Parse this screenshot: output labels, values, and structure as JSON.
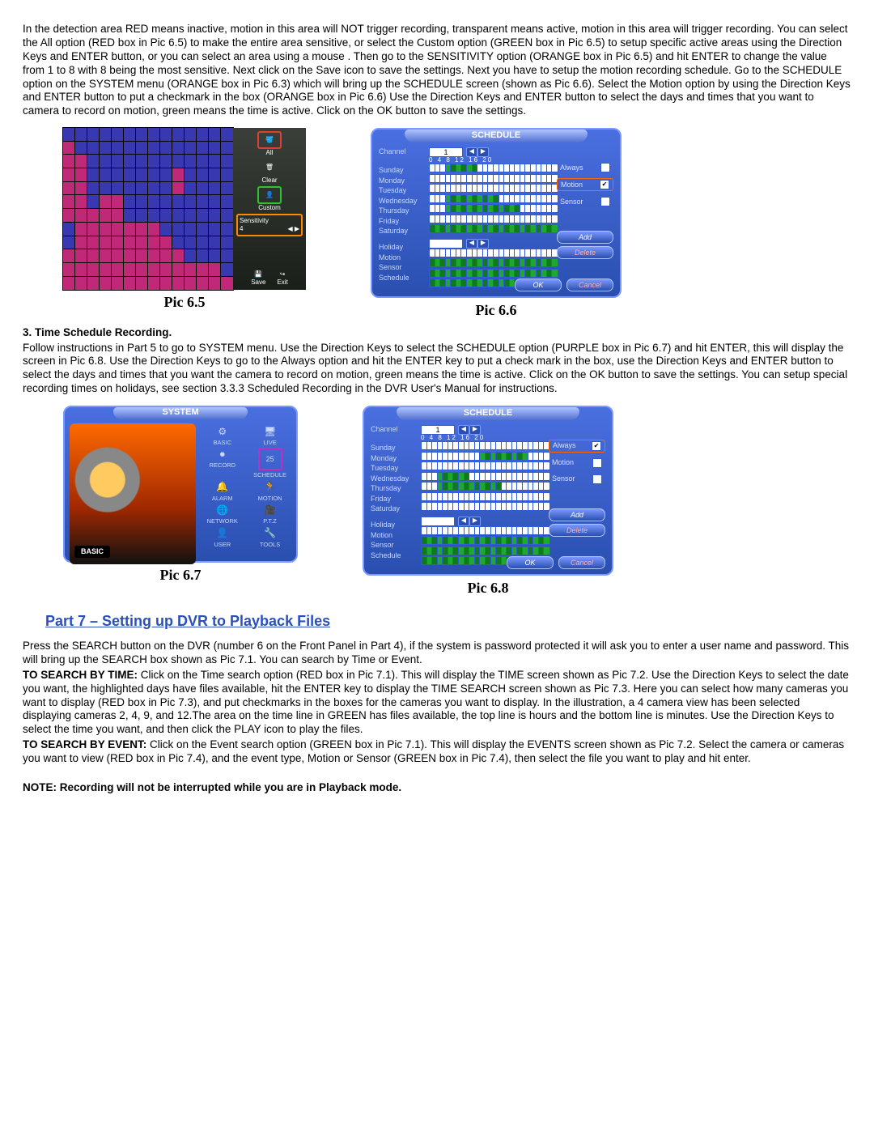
{
  "para1": "In the detection area RED means inactive, motion in this area will NOT trigger recording, transparent means active, motion in this area will trigger recording. You can select the All option (RED box in Pic 6.5) to make the entire area sensitive, or select the Custom option (GREEN box in Pic 6.5) to setup specific active areas using the Direction Keys and ENTER button, or you can select an area using a mouse . Then go to the SENSITIVITY option (ORANGE box in Pic 6.5) and hit ENTER to change the value from 1 to 8 with 8 being the most sensitive. Next click on the Save icon to save the settings. Next you have to setup the motion recording schedule. Go to the SCHEDULE option on the SYSTEM menu (ORANGE box in Pic 6.3) which will bring up the SCHEDULE screen (shown as Pic 6.6).  Select the Motion option by using the Direction Keys and ENTER button to put a checkmark in the box (ORANGE box in Pic 6.6) Use the Direction Keys and ENTER button to select the days and times that you want to camera to record on motion, green means the time is active. Click on the OK button to save the settings.",
  "pic65": {
    "caption": "Pic 6.5",
    "side": {
      "all": "All",
      "clear": "Clear",
      "custom": "Custom",
      "sens_label": "Sensitivity",
      "sens_val": "4",
      "save": "Save",
      "exit": "Exit"
    }
  },
  "pic66": {
    "caption": "Pic 6.6",
    "title": "SCHEDULE",
    "labels": {
      "channel": "Channel",
      "sunday": "Sunday",
      "monday": "Monday",
      "tuesday": "Tuesday",
      "wednesday": "Wednesday",
      "thursday": "Thursday",
      "friday": "Friday",
      "saturday": "Saturday",
      "holiday": "Holiday",
      "motion": "Motion",
      "sensor": "Sensor",
      "schedule": "Schedule"
    },
    "channel_val": "1",
    "ticks": "0    4    8    12   16   20",
    "opts": {
      "always": "Always",
      "motion": "Motion",
      "sensor": "Sensor"
    },
    "btns": {
      "add": "Add",
      "delete": "Delete",
      "ok": "OK",
      "cancel": "Cancel"
    }
  },
  "heading_tsr": "3. Time Schedule Recording.",
  "para_tsr": "Follow instructions in Part 5 to go to SYSTEM menu. Use the Direction Keys to select the SCHEDULE option (PURPLE box in Pic 6.7) and hit ENTER, this will display the screen in Pic 6.8.  Use the Direction Keys to go to the Always option and hit the ENTER key to put a check mark in the box, use the Direction Keys and ENTER button to select the days and times that you want the camera to record on motion, green means the time is active. Click on the OK button to save the settings. You can setup special recording times on holidays, see section 3.3.3 Scheduled Recording in the DVR User's Manual for instructions.",
  "pic67": {
    "caption": "Pic 6.7",
    "title": "SYSTEM",
    "badge": "BASIC",
    "items": {
      "basic": "BASIC",
      "live": "LIVE",
      "record": "RECORD",
      "schedule": "SCHEDULE",
      "sched_num": "25",
      "alarm": "ALARM",
      "motion": "MOTION",
      "network": "NETWORK",
      "ptz": "P.T.Z",
      "user": "USER",
      "tools": "TOOLS"
    }
  },
  "pic68": {
    "caption": "Pic 6.8",
    "title": "SCHEDULE",
    "channel_val": "1"
  },
  "part7_title": "Part 7 – Setting up DVR to Playback Files",
  "para7a": "Press the SEARCH button on the DVR (number 6 on the Front Panel in Part 4), if the system is password protected it will ask you to enter a user name and password. This will bring up the SEARCH box shown as Pic 7.1. You can search by Time or Event.",
  "tsbt_label": " TO SEARCH BY TIME: ",
  "para7b": "Click on the Time search option (RED box in Pic 7.1). This will display the TIME screen shown as Pic 7.2. Use the Direction Keys to select the date you want, the highlighted days have files available, hit the ENTER key to display the TIME SEARCH screen shown as Pic 7.3. Here you can select how many cameras you want to display (RED box in Pic 7.3), and put checkmarks in the boxes for the cameras you want to display. In the illustration, a 4 camera view has been selected displaying cameras 2, 4, 9, and 12.The area on the time line in GREEN has files available, the top line is hours and the bottom line is minutes.  Use the Direction Keys to select the time you want, and then click the PLAY icon to play the files.",
  "tsbe_label": "TO SEARCH BY EVENT: ",
  "para7c": "Click on the Event search option (GREEN box in Pic 7.1). This will display the EVENTS screen shown as Pic 7.2. Select the camera or cameras you want to view (RED box in Pic 7.4), and the event type, Motion or Sensor (GREEN box in Pic 7.4), then select the file you want to play and hit enter.",
  "note": "NOTE: Recording will not be interrupted while you are in Playback mode."
}
